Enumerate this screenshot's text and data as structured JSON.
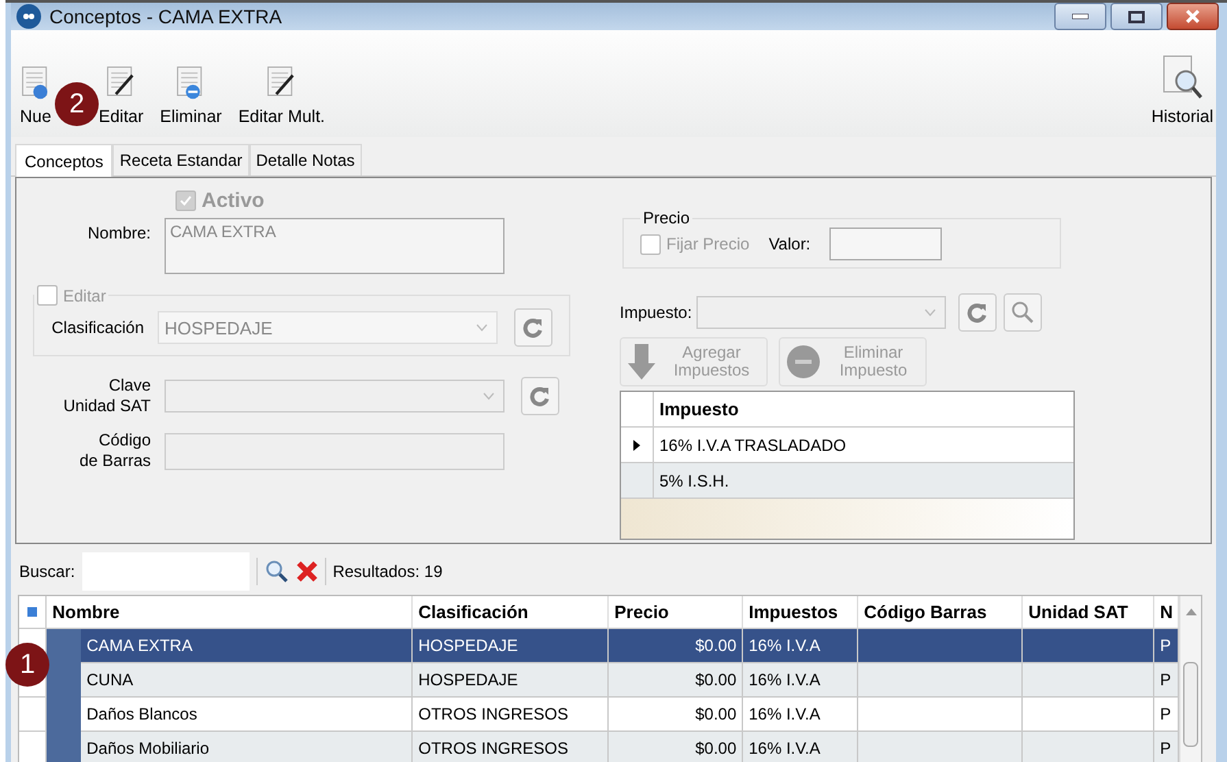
{
  "window": {
    "title": "Conceptos - CAMA EXTRA"
  },
  "toolbar": [
    {
      "kind": "new",
      "label": "Nue"
    },
    {
      "kind": "edit",
      "label": "Editar"
    },
    {
      "kind": "delete",
      "label": "Eliminar"
    },
    {
      "kind": "edit",
      "label": "Editar Mult."
    }
  ],
  "history_button": {
    "label": "Historial"
  },
  "tabs": [
    {
      "label": "Conceptos",
      "selected": true
    },
    {
      "label": "Receta Estandar",
      "selected": false
    },
    {
      "label": "Detalle Notas",
      "selected": false
    }
  ],
  "form": {
    "activo": {
      "label": "Activo",
      "checked": true
    },
    "nombre": {
      "label": "Nombre:",
      "value": "CAMA EXTRA"
    },
    "editar": {
      "label": "Editar",
      "checked": false
    },
    "clasificacion": {
      "label": "Clasificación",
      "value": "HOSPEDAJE"
    },
    "clave_unidad_sat": {
      "label": "Clave\nUnidad SAT"
    },
    "codigo_barras": {
      "label": "Código\nde Barras"
    },
    "precio": {
      "title": "Precio",
      "fijar": {
        "label": "Fijar Precio",
        "checked": false
      },
      "valor_label": "Valor:"
    },
    "impuesto": {
      "label": "Impuesto:"
    },
    "buttons": [
      {
        "kind": "add",
        "label": "Agregar\nImpuestos"
      },
      {
        "kind": "remove",
        "label": "Eliminar\nImpuesto"
      }
    ],
    "tax_table": {
      "header": "Impuesto",
      "rows": [
        {
          "text": "16%  I.V.A TRASLADADO",
          "selected": true
        },
        {
          "text": "5% I.S.H.",
          "selected": false
        }
      ]
    }
  },
  "search": {
    "label": "Buscar:",
    "results": "Resultados:  19"
  },
  "grid": {
    "columns": [
      "Nombre",
      "Clasificación",
      "Precio",
      "Impuestos",
      "Código Barras",
      "Unidad SAT",
      "N"
    ],
    "rows": [
      {
        "selected": true,
        "cells": [
          "CAMA EXTRA",
          "HOSPEDAJE",
          "$0.00",
          "16% I.V.A",
          null,
          null,
          "P"
        ]
      },
      {
        "selected": false,
        "cells": [
          "CUNA",
          "HOSPEDAJE",
          "$0.00",
          "16% I.V.A",
          null,
          null,
          "P"
        ]
      },
      {
        "selected": false,
        "cells": [
          "Daños Blancos",
          "OTROS INGRESOS",
          "$0.00",
          "16% I.V.A",
          null,
          null,
          "P"
        ]
      },
      {
        "selected": false,
        "cells": [
          "Daños Mobiliario",
          "OTROS INGRESOS",
          "$0.00",
          "16% I.V.A",
          null,
          null,
          "P"
        ]
      }
    ]
  },
  "callouts": [
    {
      "number": "2"
    },
    {
      "number": "1"
    }
  ]
}
